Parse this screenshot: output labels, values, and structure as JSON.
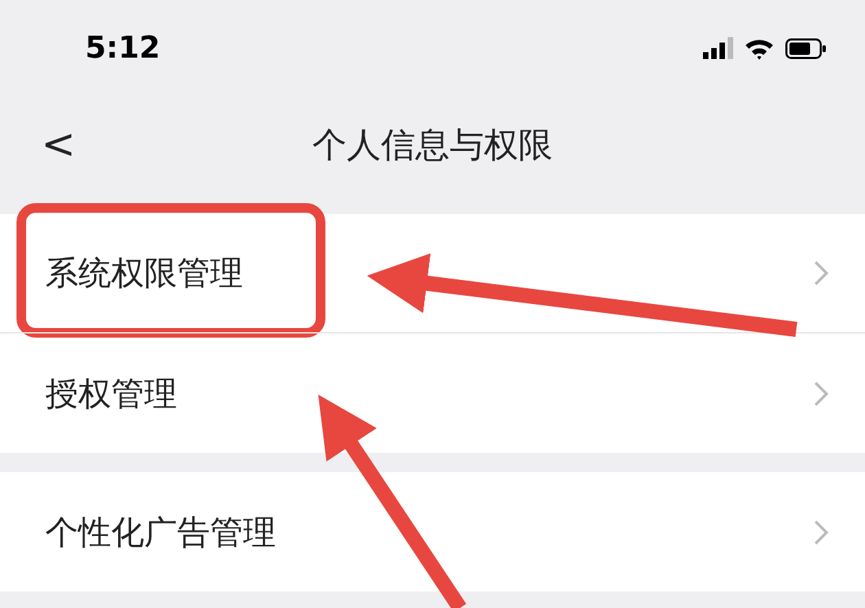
{
  "status_bar": {
    "time": "5:12"
  },
  "nav": {
    "back": "<",
    "title": "个人信息与权限"
  },
  "groups": [
    [
      {
        "label": "系统权限管理",
        "highlighted": true
      },
      {
        "label": "授权管理",
        "highlighted": false
      }
    ],
    [
      {
        "label": "个性化广告管理",
        "highlighted": false
      }
    ]
  ]
}
